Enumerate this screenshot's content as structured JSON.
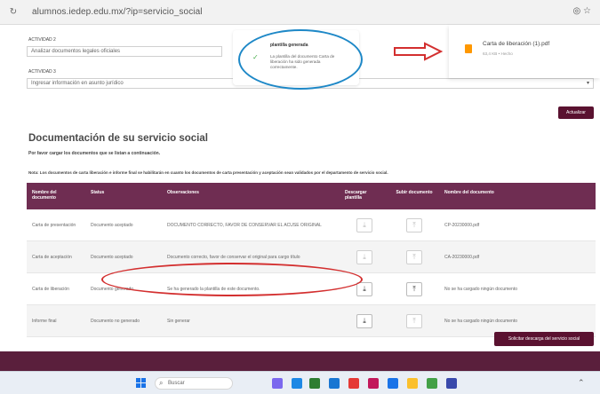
{
  "browser": {
    "tab_icon": "reload",
    "url": "alumnos.iedep.edu.mx/?ip=servicio_social",
    "right_icons": "◎ ☆"
  },
  "form": {
    "field2_label": "ACTIVIDAD 2",
    "field2_value": "Analizar documentos legales oficiales",
    "field3_label": "ACTIVIDAD 3",
    "field3_value": "Ingresar información en asunto jurídico",
    "save_label": "Actualizar"
  },
  "section": {
    "title": "Documentación de su servicio social",
    "instruction1": "Por favor cargar los documentos que se listan a continuación.",
    "instruction2": "Nota: Los documentos de carta liberación e informe final se habilitarán en cuanto los documentos de carta presentación y aceptación sean validados por el departamento de servicio social."
  },
  "table": {
    "headers": [
      "Nombre del documento",
      "Status",
      "Observaciones",
      "Descargar plantilla",
      "Subir documento",
      "Nombre del documento"
    ],
    "rows": [
      {
        "name": "Carta de presentación",
        "status": "Documento aceptado",
        "obs": "DOCUMENTO CORRECTO, FAVOR DE CONSERVAR EL ACUSE ORIGINAL",
        "file": "CP-20230000.pdf"
      },
      {
        "name": "Carta de aceptación",
        "status": "Documento aceptado",
        "obs": "Documento correcto, favor de conservar el original para cargo título",
        "file": "CA-20230000.pdf"
      },
      {
        "name": "Carta de liberación",
        "status": "Documento generado",
        "obs": "Se ha generado la plantilla de este documento.",
        "file": "No se ha cargado ningún documento"
      },
      {
        "name": "Informe final",
        "status": "Documento no generado",
        "obs": "Sin generar",
        "file": "No se ha cargado ningún documento"
      }
    ],
    "action_button": "Solicitar descarga del servicio social"
  },
  "notification": {
    "title": "plantilla generada",
    "text": "La plantilla del documento Carta de liberación ha sido generada correctamente."
  },
  "download": {
    "filename": "Carta de liberación (1).pdf",
    "size": "63,4 KB • Hecho"
  },
  "taskbar": {
    "search_placeholder": "Buscar"
  },
  "colors": {
    "accent": "#6f2d52",
    "annotation_blue": "#1e88c7",
    "annotation_red": "#d32f2f"
  }
}
